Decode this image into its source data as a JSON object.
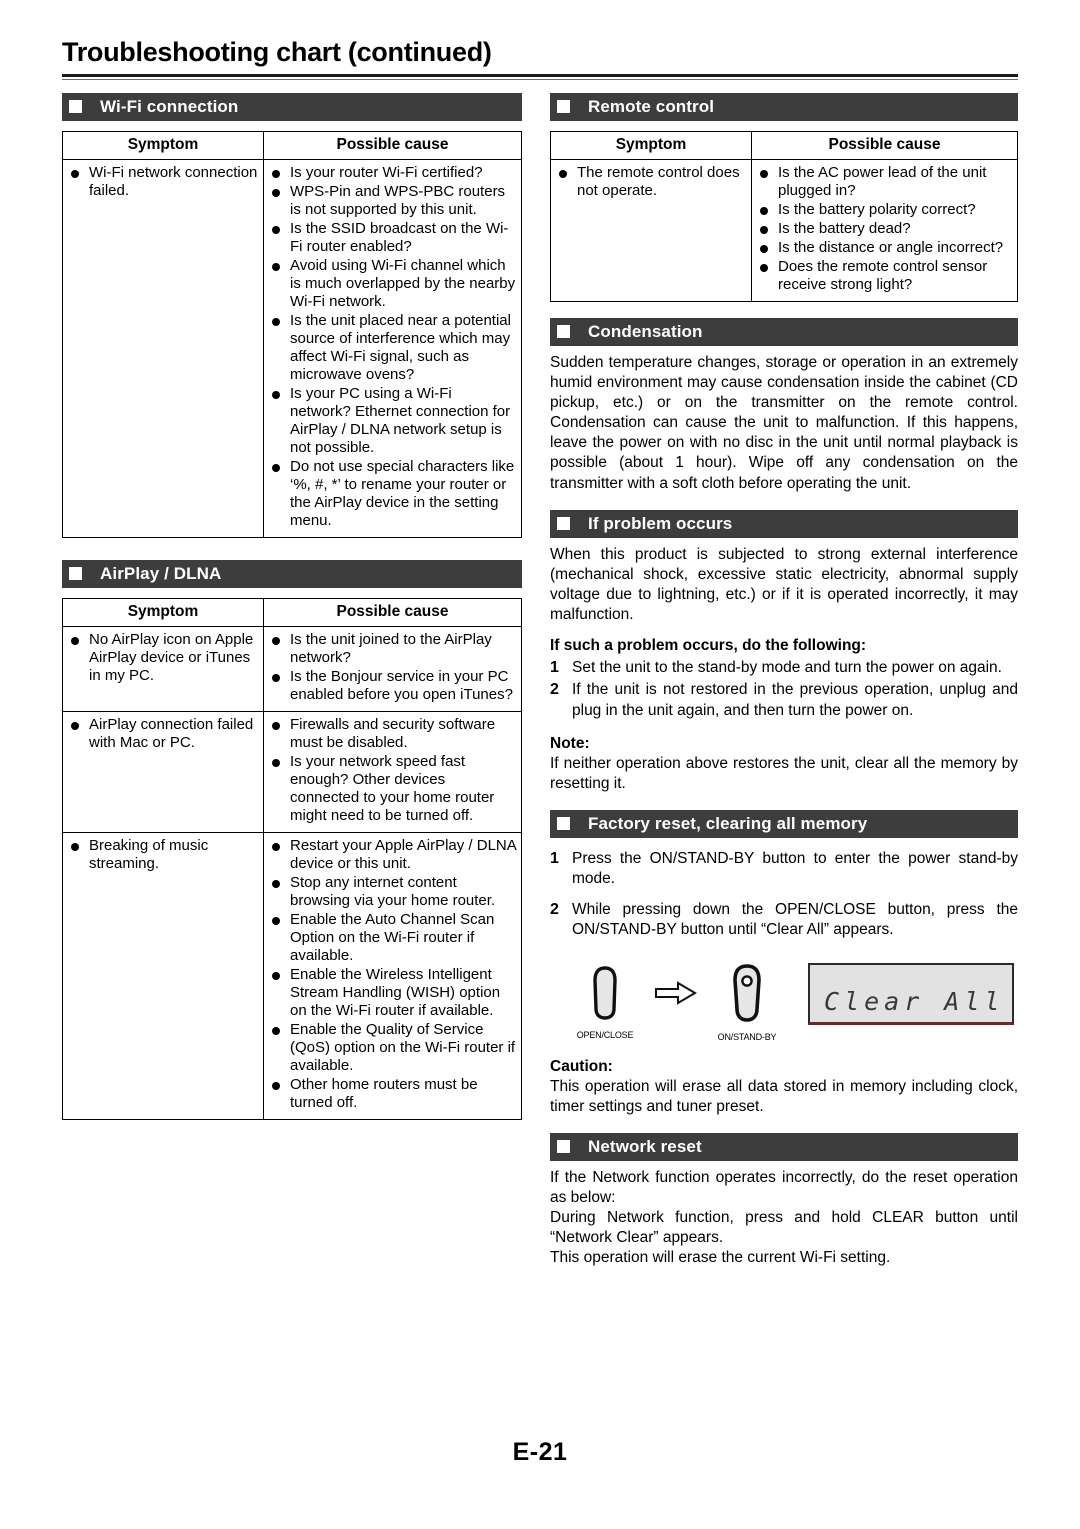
{
  "page": {
    "title": "Troubleshooting chart (continued)",
    "footer_page_number": "E-21"
  },
  "table_headers": {
    "symptom": "Symptom",
    "possible_cause": "Possible cause"
  },
  "sections": {
    "wifi": {
      "heading": "Wi-Fi connection",
      "rows": [
        {
          "symptom": [
            "Wi-Fi network connection failed."
          ],
          "causes": [
            "Is your router Wi-Fi certified?",
            "WPS-Pin and WPS-PBC routers is not supported by this unit.",
            "Is the SSID broadcast on the Wi-Fi router enabled?",
            "Avoid using Wi-Fi channel which is much overlapped by the nearby Wi-Fi network.",
            "Is the unit placed near a potential source of interference which may affect Wi-Fi signal, such as microwave ovens?",
            "Is your PC using a Wi-Fi network? Ethernet connection for AirPlay / DLNA network setup is not possible.",
            "Do not use special characters like ‘%, #, *’ to rename your router or the AirPlay device in the setting menu."
          ]
        }
      ]
    },
    "airplay": {
      "heading": "AirPlay / DLNA",
      "rows": [
        {
          "symptom": [
            "No AirPlay icon on Apple AirPlay device or iTunes in my PC."
          ],
          "causes": [
            "Is the unit joined to the AirPlay network?",
            "Is the Bonjour service in your PC enabled before you open iTunes?"
          ]
        },
        {
          "symptom": [
            "AirPlay connection failed with Mac or PC."
          ],
          "causes": [
            "Firewalls and security software must be disabled.",
            "Is your network speed fast enough? Other devices connected to your home router might need to be turned off."
          ]
        },
        {
          "symptom": [
            "Breaking of music streaming."
          ],
          "causes": [
            "Restart your Apple AirPlay / DLNA device or this unit.",
            "Stop any internet content browsing via your home router.",
            "Enable the Auto Channel Scan Option on the Wi-Fi router if available.",
            "Enable the Wireless Intelligent Stream Handling (WISH) option on the Wi-Fi router if available.",
            "Enable the Quality of Service (QoS) option on the Wi-Fi router if available.",
            "Other home routers must be turned off."
          ]
        }
      ]
    },
    "remote_control": {
      "heading": "Remote control",
      "rows": [
        {
          "symptom": [
            "The remote control does not operate."
          ],
          "causes": [
            "Is the AC power lead of the unit plugged in?",
            "Is the battery polarity correct?",
            "Is the battery dead?",
            "Is the distance or angle incorrect?",
            "Does the remote control sensor receive strong light?"
          ]
        }
      ]
    },
    "condensation": {
      "heading": "Condensation",
      "body": "Sudden temperature changes, storage or operation in an extremely humid environment may cause condensation inside the cabinet (CD pickup, etc.) or on the transmitter on the remote control. Condensation can cause the unit to malfunction. If this happens, leave the power on with no disc in the unit until normal playback is possible (about 1 hour). Wipe off any condensation on the transmitter with a soft cloth before operating the unit."
    },
    "if_problem_occurs": {
      "heading": "If problem occurs",
      "intro": "When this product is subjected to strong external interference (mechanical shock, excessive static electricity, abnormal supply voltage due to lightning, etc.) or if it is operated incorrectly, it may malfunction.",
      "steps_lead": "If such a problem occurs, do the following:",
      "steps": [
        "Set the unit to the stand-by mode and turn the power on again.",
        "If the unit is not restored in the previous operation, unplug and plug in the unit again, and then turn the power on."
      ],
      "note_label": "Note:",
      "note_body": "If neither operation above restores the unit, clear all the memory by resetting it."
    },
    "factory_reset": {
      "heading": "Factory reset, clearing all memory",
      "steps": [
        "Press the ON/STAND-BY button to enter the power stand-by mode.",
        "While pressing down the OPEN/CLOSE button, press the ON/STAND-BY button until “Clear All” appears."
      ],
      "diagram": {
        "button_1_label": "OPEN/CLOSE",
        "button_2_label": "ON/STAND-BY",
        "arrow_icon": "right-arrow-icon",
        "display_text": "Clear All"
      },
      "caution_label": "Caution:",
      "caution_body": "This operation will erase all data stored in memory including clock, timer settings and tuner preset."
    },
    "network_reset": {
      "heading": "Network reset",
      "line1": "If the Network function operates incorrectly, do the reset operation as below:",
      "line2": "During Network function, press and hold CLEAR button until “Network Clear” appears.",
      "line3": "This operation will erase the current Wi-Fi setting."
    }
  },
  "colors": {
    "section_bar_bg": "#3d3d3d",
    "section_bar_text": "#ffffff",
    "rule": "#1a1a1a",
    "lcd_bg": "#e2e2e2"
  }
}
